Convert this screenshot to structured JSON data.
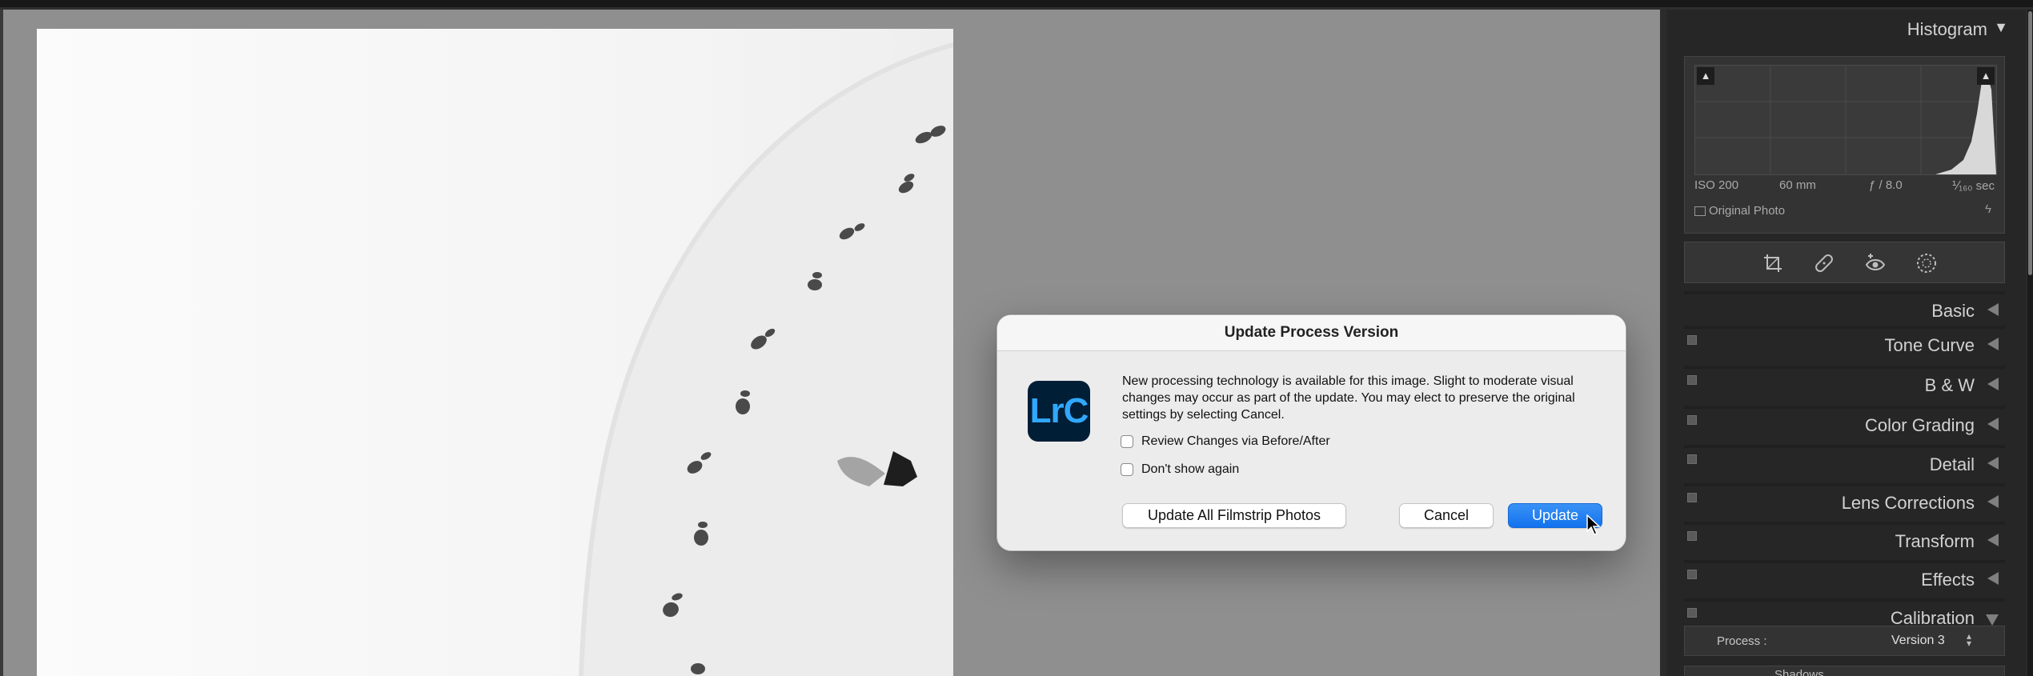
{
  "dialog": {
    "title": "Update Process Version",
    "app_logo_text": "LrC",
    "message": "New processing technology is available for this image. Slight to moderate visual changes may occur as part of the update. You may elect to preserve the original settings by selecting Cancel.",
    "checkbox_review": "Review Changes via Before/After",
    "checkbox_dont_show": "Don't show again",
    "btn_update_all": "Update All Filmstrip Photos",
    "btn_cancel": "Cancel",
    "btn_update": "Update"
  },
  "histogram": {
    "title": "Histogram",
    "iso": "ISO 200",
    "focal": "60 mm",
    "aperture": "ƒ / 8.0",
    "shutter": "⅟₁₆₀ sec",
    "original_photo": "Original Photo"
  },
  "tools": [
    "crop-tool-icon",
    "healing-tool-icon",
    "redeye-tool-icon",
    "masking-tool-icon"
  ],
  "sections": {
    "basic": "Basic",
    "tone_curve": "Tone Curve",
    "bw": "B & W",
    "color_grading": "Color Grading",
    "detail": "Detail",
    "lens_corrections": "Lens Corrections",
    "transform": "Transform",
    "effects": "Effects",
    "calibration": "Calibration"
  },
  "calibration": {
    "process_label": "Process :",
    "process_value": "Version 3",
    "next_label": "Shadows"
  },
  "colors": {
    "accent": "#1a7ff0",
    "panel_bg": "#262626",
    "lrc_bg": "#001e36",
    "lrc_fg": "#31a8ff"
  }
}
